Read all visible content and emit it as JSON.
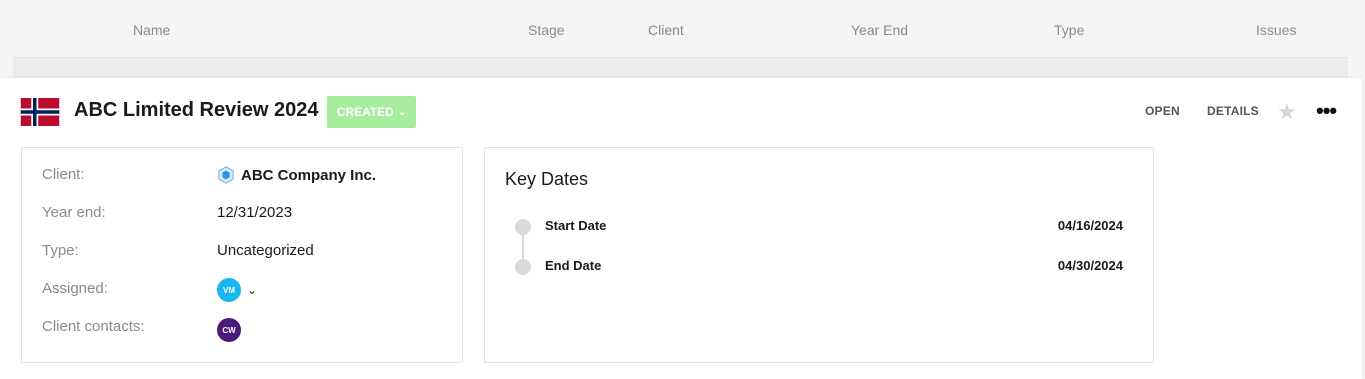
{
  "columns": [
    "Name",
    "Stage",
    "Client",
    "Year End",
    "Type",
    "Issues"
  ],
  "engagement": {
    "title": "ABC Limited Review 2024",
    "status": "CREATED",
    "actions": {
      "open": "OPEN",
      "details": "DETAILS"
    },
    "flag_icon": "norway-flag-icon"
  },
  "info": {
    "client_label": "Client:",
    "client_value": "ABC Company Inc.",
    "year_end_label": "Year end:",
    "year_end_value": "12/31/2023",
    "type_label": "Type:",
    "type_value": "Uncategorized",
    "assigned_label": "Assigned:",
    "assigned_initials": "VM",
    "contacts_label": "Client contacts:",
    "contacts_initials": "CW"
  },
  "key_dates": {
    "title": "Key Dates",
    "items": [
      {
        "label": "Start Date",
        "value": "04/16/2024"
      },
      {
        "label": "End Date",
        "value": "04/30/2024"
      }
    ]
  },
  "colors": {
    "status_bg": "#a8ec9f",
    "avatar_vm": "#1ab6f0",
    "avatar_cw": "#4c1a7a"
  }
}
